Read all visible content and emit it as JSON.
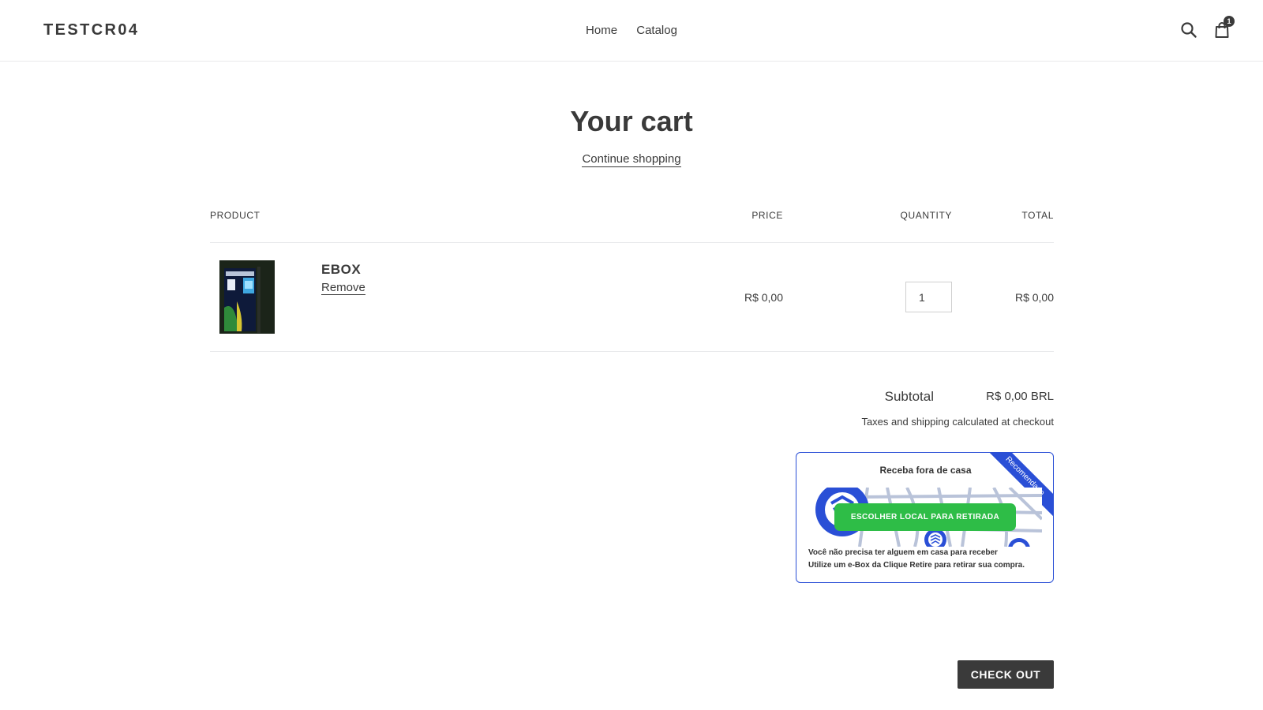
{
  "header": {
    "logo": "TESTCR04",
    "nav": [
      "Home",
      "Catalog"
    ],
    "cart_count": "1"
  },
  "page": {
    "title": "Your cart",
    "continue_label": "Continue shopping"
  },
  "table": {
    "headers": {
      "product": "PRODUCT",
      "price": "PRICE",
      "quantity": "QUANTITY",
      "total": "TOTAL"
    },
    "items": [
      {
        "title": "EBOX",
        "remove_label": "Remove",
        "price": "R$ 0,00",
        "quantity": "1",
        "total": "R$ 0,00"
      }
    ]
  },
  "summary": {
    "subtotal_label": "Subtotal",
    "subtotal_value": "R$ 0,00 BRL",
    "tax_note": "Taxes and shipping calculated at checkout"
  },
  "widget": {
    "ribbon": "Recomendado",
    "title": "Receba fora de casa",
    "cta": "ESCOLHER LOCAL PARA RETIRADA",
    "line1": "Você não precisa ter alguem em casa para receber",
    "line2": "Utilize um e-Box da Clique Retire para retirar sua compra.",
    "accent_color": "#2a4fd6",
    "cta_color": "#2ebd47"
  },
  "checkout_label": "CHECK OUT"
}
